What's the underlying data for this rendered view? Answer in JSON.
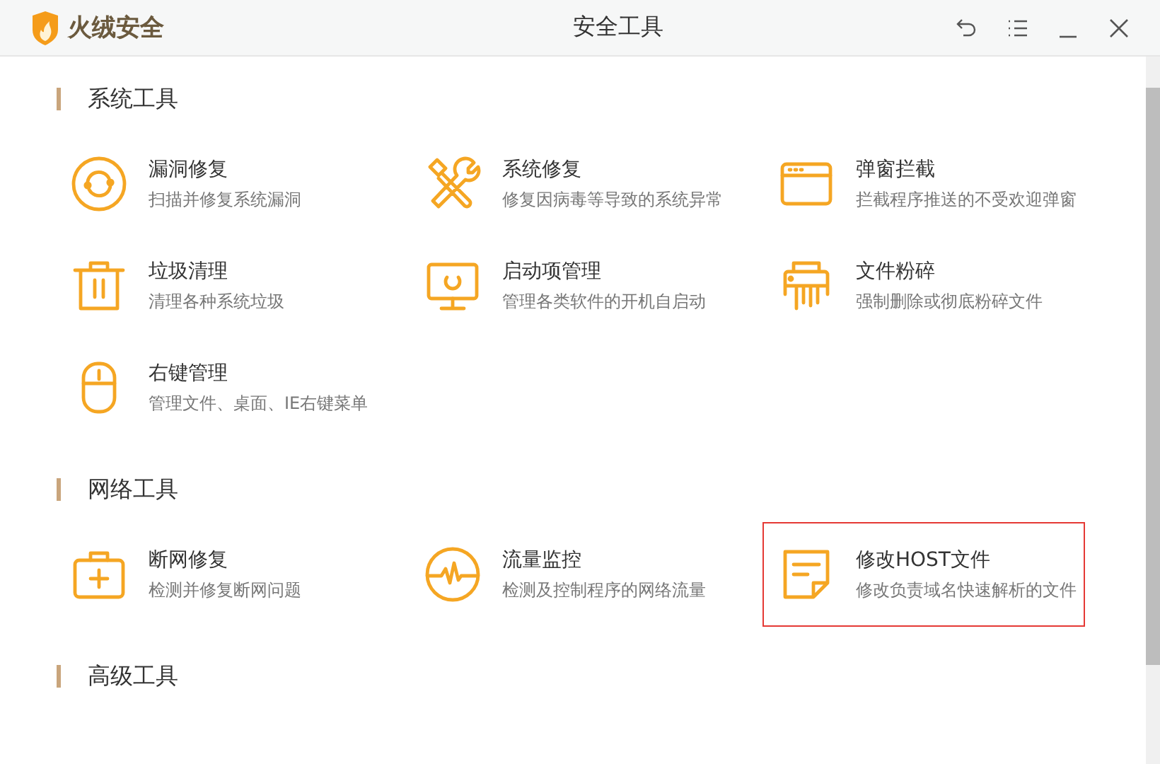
{
  "window": {
    "brand": "火绒安全",
    "title": "安全工具"
  },
  "sections": [
    {
      "title": "系统工具",
      "items": [
        {
          "kind": "vulnerability",
          "name": "漏洞修复",
          "desc": "扫描并修复系统漏洞",
          "selected": false
        },
        {
          "kind": "tools",
          "name": "系统修复",
          "desc": "修复因病毒等导致的系统异常",
          "selected": false
        },
        {
          "kind": "popup",
          "name": "弹窗拦截",
          "desc": "拦截程序推送的不受欢迎弹窗",
          "selected": false
        },
        {
          "kind": "trash",
          "name": "垃圾清理",
          "desc": "清理各种系统垃圾",
          "selected": false
        },
        {
          "kind": "monitor",
          "name": "启动项管理",
          "desc": "管理各类软件的开机自启动",
          "selected": false
        },
        {
          "kind": "shredder",
          "name": "文件粉碎",
          "desc": "强制删除或彻底粉碎文件",
          "selected": false
        },
        {
          "kind": "mouse",
          "name": "右键管理",
          "desc": "管理文件、桌面、IE右键菜单",
          "selected": false
        }
      ]
    },
    {
      "title": "网络工具",
      "items": [
        {
          "kind": "kit",
          "name": "断网修复",
          "desc": "检测并修复断网问题",
          "selected": false
        },
        {
          "kind": "pulse",
          "name": "流量监控",
          "desc": "检测及控制程序的网络流量",
          "selected": false
        },
        {
          "kind": "note",
          "name": "修改HOST文件",
          "desc": "修改负责域名快速解析的文件",
          "selected": true
        }
      ]
    },
    {
      "title": "高级工具"
    }
  ]
}
